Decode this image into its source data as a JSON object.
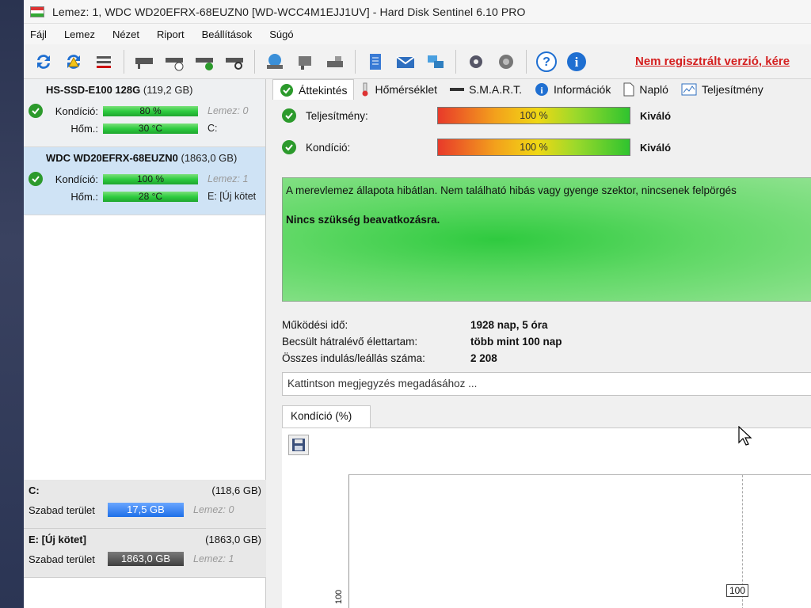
{
  "window": {
    "title": "Lemez: 1, WDC WD20EFRX-68EUZN0 [WD-WCC4M1EJJ1UV]  -  Hard Disk Sentinel 6.10 PRO"
  },
  "menu": [
    "Fájl",
    "Lemez",
    "Nézet",
    "Riport",
    "Beállítások",
    "Súgó"
  ],
  "toolbar": {
    "unregistered": "Nem regisztrált verzió, kére"
  },
  "disks": [
    {
      "name": "HS-SSD-E100 128G",
      "size": "(119,2 GB)",
      "condition_label": "Kondíció:",
      "condition_value": "80 %",
      "condition_level": 0.8,
      "disk_ref": "Lemez: 0",
      "temp_label": "Hőm.:",
      "temp_value": "30 °C",
      "drive": "C:"
    },
    {
      "name": "WDC WD20EFRX-68EUZN0",
      "size": "(1863,0 GB)",
      "condition_label": "Kondíció:",
      "condition_value": "100 %",
      "condition_level": 1.0,
      "disk_ref": "Lemez: 1",
      "temp_label": "Hőm.:",
      "temp_value": "28 °C",
      "drive": "E: [Új kötet"
    }
  ],
  "volumes": [
    {
      "name": "C:",
      "size": "(118,6 GB)",
      "free_label": "Szabad terület",
      "free_value": "17,5 GB",
      "disk_ref": "Lemez: 0"
    },
    {
      "name": "E: [Új kötet]",
      "size": "(1863,0 GB)",
      "free_label": "Szabad terület",
      "free_value": "1863,0 GB",
      "disk_ref": "Lemez: 1"
    }
  ],
  "tabs": [
    "Áttekintés",
    "Hőmérséklet",
    "S.M.A.R.T.",
    "Információk",
    "Napló",
    "Teljesítmény"
  ],
  "overview": {
    "performance_label": "Teljesítmény:",
    "performance_value": "100 %",
    "performance_rating": "Kiváló",
    "condition_label": "Kondíció:",
    "condition_value": "100 %",
    "condition_rating": "Kiváló",
    "message": "A merevlemez állapota hibátlan. Nem található hibás vagy gyenge szektor, nincsenek felpörgés",
    "action": "Nincs szükség beavatkozásra.",
    "stats": [
      {
        "key": "Működési idő:",
        "value": "1928 nap, 5 óra"
      },
      {
        "key": "Becsült hátralévő élettartam:",
        "value": "több mint 100 nap"
      },
      {
        "key": "Összes indulás/leállás száma:",
        "value": "2 208"
      }
    ],
    "note_placeholder": "Kattintson megjegyzés megadásához ..."
  },
  "chart": {
    "tab_label": "Kondíció  (%)",
    "point_label": "100",
    "y_tick": "100"
  },
  "colors": {
    "accent_green": "#2ecc40",
    "unregistered_red": "#d42020",
    "selected_row": "#cfe3f5"
  }
}
